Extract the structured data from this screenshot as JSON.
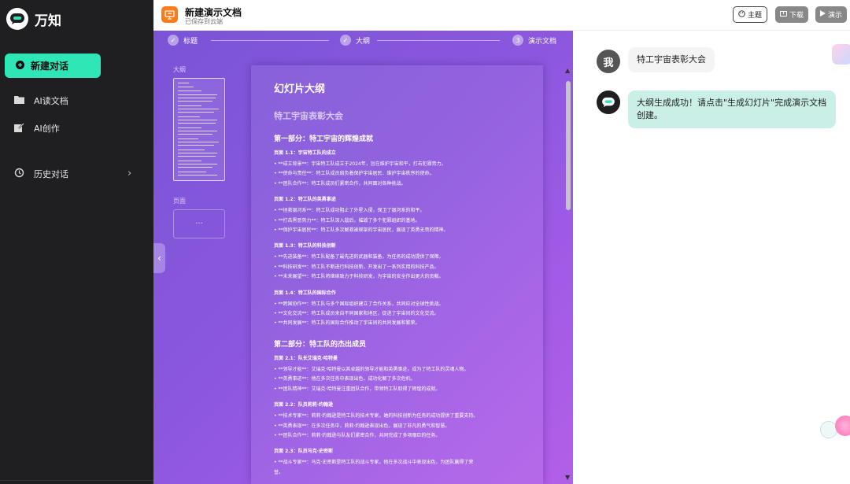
{
  "app": {
    "name": "万知"
  },
  "sidebar": {
    "new_chat": "新建对话",
    "items": [
      {
        "label": "AI读文档",
        "icon": "folder-icon"
      },
      {
        "label": "AI创作",
        "icon": "edit-icon"
      },
      {
        "label": "历史对话",
        "icon": "history-icon"
      }
    ]
  },
  "topbar": {
    "title": "新建演示文档",
    "subtitle": "已保存到云端",
    "theme_btn": "主题",
    "download_btn": "下载",
    "present_btn": "演示"
  },
  "steps": [
    {
      "label": "标题",
      "marker": "✓"
    },
    {
      "label": "大纲",
      "marker": "✓"
    },
    {
      "label": "演示文档",
      "marker": "3"
    }
  ],
  "panel": {
    "outline_label": "大纲",
    "pages_label": "页面",
    "page_placeholder": "···"
  },
  "document": {
    "heading": "幻灯片大纲",
    "subtitle": "特工宇宙表彰大会",
    "part1": {
      "title": "第一部分：特工宇宙的辉煌成就",
      "sections": [
        {
          "title": "页面 1.1：宇宙特工队的成立",
          "bullets": [
            "• **成立背景**：宇宙特工队成立于2024年，旨在维护宇宙和平，打击犯罪势力。",
            "• **使命与责任**：特工队成员肩负着保护宇宙居民、维护宇宙秩序的使命。",
            "• **团队合作**：特工队成员们紧密合作，共同面对各种挑战。"
          ]
        },
        {
          "title": "页面 1.2：特工队的英勇事迹",
          "bullets": [
            "• **拯救银河系**：特工队成功阻止了外星入侵，保卫了银河系的和平。",
            "• **打击黑恶势力**：特工队深入敌后，摧毁了多个犯罪组织的基地。",
            "• **保护宇宙居民**：特工队多次解救被绑架的宇宙居民，展现了英勇无畏的精神。"
          ]
        },
        {
          "title": "页面 1.3：特工队的科技创新",
          "bullets": [
            "• **先进装备**：特工队配备了最先进的武器和装备，为任务的成功提供了保障。",
            "• **科技研发**：特工队不断进行科技创新，开发出了一系列实用的科技产品。",
            "• **未来展望**：特工队将继续致力于科技研发，为宇宙的安全作出更大的贡献。"
          ]
        },
        {
          "title": "页面 1.4：特工队的国际合作",
          "bullets": [
            "• **跨国协作**：特工队与多个国际组织建立了合作关系，共同应对全球性挑战。",
            "• **文化交流**：特工队成员来自不同国家和地区，促进了宇宙间的文化交流。",
            "• **共同发展**：特工队的国际合作推动了宇宙间的共同发展和繁荣。"
          ]
        }
      ]
    },
    "part2": {
      "title": "第二部分：特工队的杰出成员",
      "sections": [
        {
          "title": "页面 2.1：队长艾瑞克·哈特曼",
          "bullets": [
            "• **领导才能**：艾瑞克·哈特曼以其卓越的领导才能和英勇事迹，成为了特工队的灵魂人物。",
            "• **英勇事迹**：他在多次任务中表现出色，成功化解了多次危机。",
            "• **团队精神**：艾瑞克·哈特曼注重团队合作，带领特工队取得了辉煌的成就。"
          ]
        },
        {
          "title": "页面 2.2：队员莉莉·约翰逊",
          "bullets": [
            "• **技术专家**：莉莉·约翰逊是特工队的技术专家，她的科技创新为任务的成功提供了重要支持。",
            "• **英勇表现**：在多次任务中，莉莉·约翰逊表现出色，展现了非凡的勇气和智慧。",
            "• **团队合作**：莉莉·约翰逊与队友们紧密合作，共同完成了多项艰巨的任务。"
          ]
        },
        {
          "title": "页面 2.3：队员马克·史密斯",
          "bullets": [
            "• **战斗专家**：马克·史密斯是特工队的战斗专家，他在多次战斗中表现出色，为团队赢得了荣",
            "誉。"
          ]
        }
      ]
    }
  },
  "chat": {
    "user_avatar": "我",
    "user_msg": "特工宇宙表彰大会",
    "bot_msg": "大纲生成成功！请点击\"生成幻灯片\"完成演示文档创建。"
  },
  "colors": {
    "accent": "#2ee6b6",
    "doc_icon": "#ff7a1a",
    "bot_bubble": "#c9efe6"
  }
}
